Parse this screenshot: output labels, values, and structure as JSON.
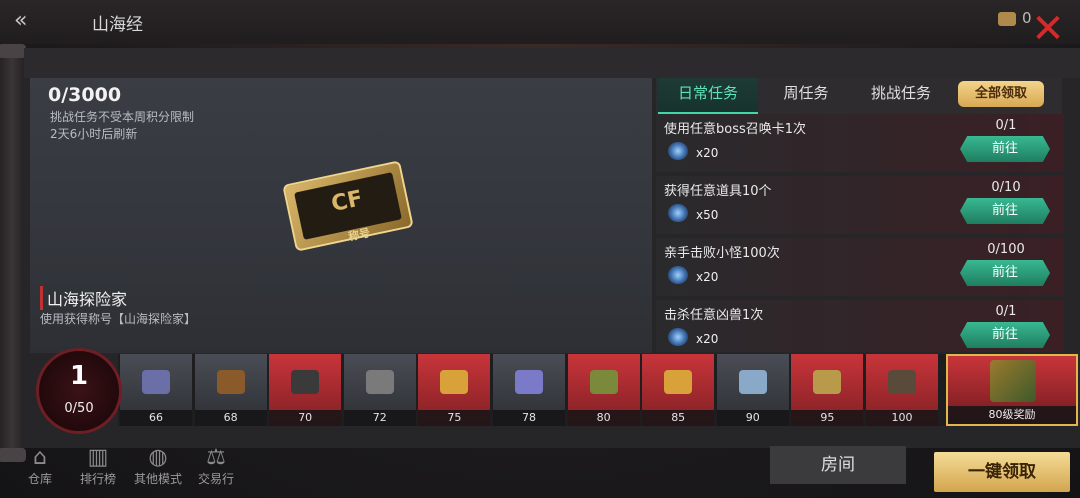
{
  "header": {
    "title": "山海经",
    "currency_count": "0",
    "back_icon": "back-chevron-icon",
    "close_icon": "close-icon"
  },
  "summary": {
    "progress": "0/3000",
    "note": "挑战任务不受本周积分限制",
    "refresh": "2天6小时后刷新"
  },
  "reward_title": {
    "name": "山海探险家",
    "desc": "使用获得称号【山海探险家】"
  },
  "badge": {
    "logo": "CF",
    "label": "称号"
  },
  "tabs": [
    {
      "label": "日常任务",
      "active": true
    },
    {
      "label": "周任务",
      "active": false
    },
    {
      "label": "挑战任务",
      "active": false
    }
  ],
  "claim_all_label": "全部领取",
  "tasks": [
    {
      "name": "使用任意boss召唤卡1次",
      "qty": "x20",
      "count": "0/1",
      "button": "前往"
    },
    {
      "name": "获得任意道具10个",
      "qty": "x50",
      "count": "0/10",
      "button": "前往"
    },
    {
      "name": "亲手击败小怪100次",
      "qty": "x20",
      "count": "0/100",
      "button": "前往"
    },
    {
      "name": "击杀任意凶兽1次",
      "qty": "x20",
      "count": "0/1",
      "button": "前往"
    }
  ],
  "level": {
    "current": "1",
    "progress": "0/50"
  },
  "rewards": [
    {
      "level": "66",
      "style": "gray",
      "color": "#6a6fa8"
    },
    {
      "level": "68",
      "style": "gray",
      "color": "#8a5a2a"
    },
    {
      "level": "70",
      "style": "red",
      "color": "#3a3a3a"
    },
    {
      "level": "72",
      "style": "gray",
      "color": "#7a7a7a"
    },
    {
      "level": "75",
      "style": "red",
      "color": "#d9a13a"
    },
    {
      "level": "78",
      "style": "gray",
      "color": "#7a7ac8"
    },
    {
      "level": "80",
      "style": "red",
      "color": "#7a8a3a"
    },
    {
      "level": "85",
      "style": "red",
      "color": "#d9a13a"
    },
    {
      "level": "90",
      "style": "gray",
      "color": "#8aa8c8"
    },
    {
      "level": "95",
      "style": "red",
      "color": "#b89a4a"
    },
    {
      "level": "100",
      "style": "red",
      "color": "#5a4a3a"
    }
  ],
  "final_reward": {
    "label": "80级奖励"
  },
  "nav": [
    {
      "label": "仓库",
      "icon": "warehouse-icon",
      "glyph": "⌂"
    },
    {
      "label": "排行榜",
      "icon": "leaderboard-icon",
      "glyph": "▥"
    },
    {
      "label": "其他模式",
      "icon": "globe-icon",
      "glyph": "◍"
    },
    {
      "label": "交易行",
      "icon": "scales-icon",
      "glyph": "⚖"
    }
  ],
  "room_label": "房间",
  "one_click_label": "一键领取"
}
